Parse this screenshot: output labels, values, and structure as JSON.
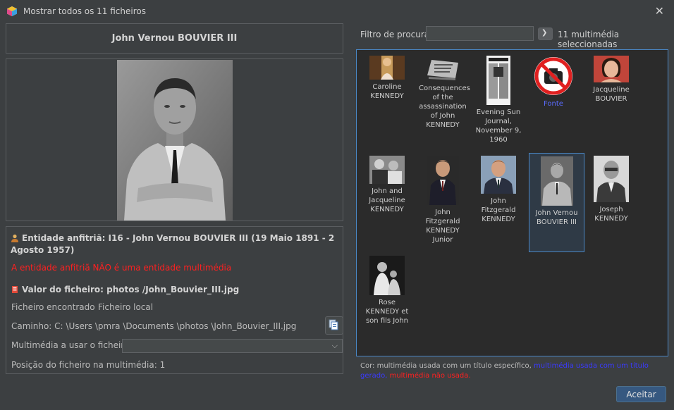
{
  "window": {
    "title": "Mostrar todos os 11 ficheiros",
    "close_icon": "close-icon"
  },
  "left": {
    "name": "John Vernou BOUVIER III",
    "host_entity": "Entidade anfitriã: I16 - John Vernou BOUVIER III (19 Maio 1891 - 2 Agosto 1957)",
    "host_warning": "A entidade anfitriã NÃO é uma entidade multimédia",
    "file_value": "Valor do ficheiro: photos /John_Bouvier_III.jpg",
    "file_found_label": "Ficheiro encontrado",
    "file_found_value": "Ficheiro local",
    "path": "Caminho: C: \\Users \\pmra \\Documents \\photos \\John_Bouvier_III.jpg",
    "media_label": "Multimédia a usar o ficheiro:",
    "media_value": "",
    "position": "Posição do ficheiro na multimédia: 1"
  },
  "right": {
    "filter_label": "Filtro de procura",
    "filter_value": "",
    "selected_count": "11 multimédia seleccionadas",
    "items": [
      {
        "caption": "Caroline KENNEDY",
        "used": "specific"
      },
      {
        "caption": "Consequences of the assassination of John KENNEDY",
        "used": "specific"
      },
      {
        "caption": "Evening Sun Journal, November 9, 1960",
        "used": "specific"
      },
      {
        "caption": "Fonte",
        "used": "generated"
      },
      {
        "caption": "Jacqueline BOUVIER",
        "used": "specific"
      },
      {
        "caption": "John and Jacqueline KENNEDY",
        "used": "specific"
      },
      {
        "caption": "John Fitzgerald KENNEDY Junior",
        "used": "specific"
      },
      {
        "caption": "John Fitzgerald KENNEDY",
        "used": "specific"
      },
      {
        "caption": "John Vernou BOUVIER III",
        "used": "specific"
      },
      {
        "caption": "Joseph KENNEDY",
        "used": "specific"
      },
      {
        "caption": "Rose KENNEDY et son fils John",
        "used": "specific"
      }
    ],
    "legend_prefix": "Cor: multimédia usada com um título específico,",
    "legend_generated": "multimédia usada com um título gerado,",
    "legend_unused": "multimédia não usada.",
    "accept_label": "Aceitar"
  },
  "colors": {
    "background": "#3c3f41",
    "grid_background": "#2b2b2b",
    "selection": "#4a88c7",
    "warning_red": "#ff2020",
    "generated_blue": "#3a3aff",
    "accept_button": "#365880"
  }
}
